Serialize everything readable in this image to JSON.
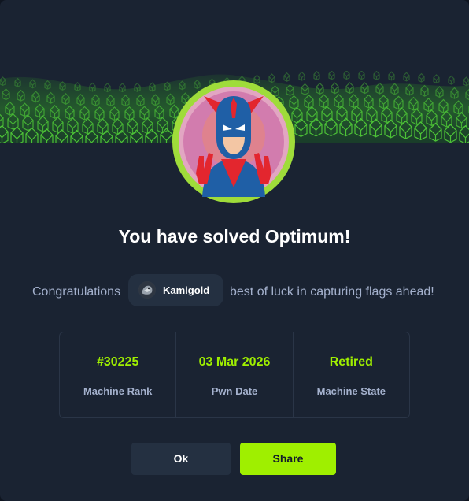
{
  "dialog": {
    "title": "You have solved Optimum!",
    "congrats_prefix": "Congratulations",
    "congrats_suffix": "best of luck in capturing flags ahead!",
    "user": {
      "name": "Kamigold",
      "avatar": "user-avatar-icon"
    },
    "machine_avatar": "machine-avatar-icon"
  },
  "stats": [
    {
      "value": "#30225",
      "label": "Machine Rank"
    },
    {
      "value": "03 Mar 2026",
      "label": "Pwn Date"
    },
    {
      "value": "Retired",
      "label": "Machine State"
    }
  ],
  "buttons": {
    "ok_label": "Ok",
    "share_label": "Share"
  },
  "colors": {
    "accent": "#9fef00",
    "background": "#1a2332",
    "muted_text": "#a4b1cd",
    "secondary_button": "#243041"
  }
}
